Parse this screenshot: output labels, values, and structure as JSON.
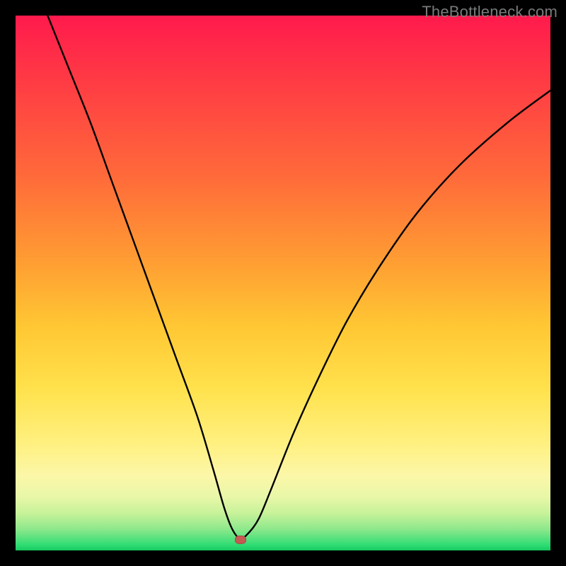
{
  "watermark": "TheBottleneck.com",
  "colors": {
    "background": "#000000",
    "curve": "#000000",
    "marker": "#c45a52"
  },
  "chart_data": {
    "type": "line",
    "title": "",
    "xlabel": "",
    "ylabel": "",
    "xlim": [
      0,
      100
    ],
    "ylim": [
      0,
      100
    ],
    "grid": false,
    "legend": false,
    "marker": {
      "x": 42,
      "y": 2
    },
    "series": [
      {
        "name": "bottleneck-curve",
        "x": [
          6,
          10,
          14,
          18,
          22,
          26,
          30,
          34,
          37,
          39,
          40.5,
          42,
          43.5,
          45.5,
          48,
          52,
          57,
          62,
          68,
          75,
          83,
          92,
          100
        ],
        "values": [
          100,
          90,
          80,
          69,
          58,
          47,
          36,
          25,
          15,
          8,
          4,
          2.2,
          3.2,
          6,
          12,
          22,
          33,
          43,
          53,
          63,
          72,
          80,
          86
        ]
      }
    ],
    "gradient_stops": [
      {
        "pos": 0,
        "color": "#ff1a4d"
      },
      {
        "pos": 12,
        "color": "#ff3a44"
      },
      {
        "pos": 30,
        "color": "#ff6a3a"
      },
      {
        "pos": 45,
        "color": "#ff9a33"
      },
      {
        "pos": 58,
        "color": "#ffc733"
      },
      {
        "pos": 70,
        "color": "#ffe24d"
      },
      {
        "pos": 80,
        "color": "#fff080"
      },
      {
        "pos": 86,
        "color": "#fcf7a8"
      },
      {
        "pos": 90,
        "color": "#e8f7a8"
      },
      {
        "pos": 93,
        "color": "#c8f29a"
      },
      {
        "pos": 96,
        "color": "#8ee88c"
      },
      {
        "pos": 99,
        "color": "#2fdc74"
      },
      {
        "pos": 100,
        "color": "#16c95f"
      }
    ]
  }
}
